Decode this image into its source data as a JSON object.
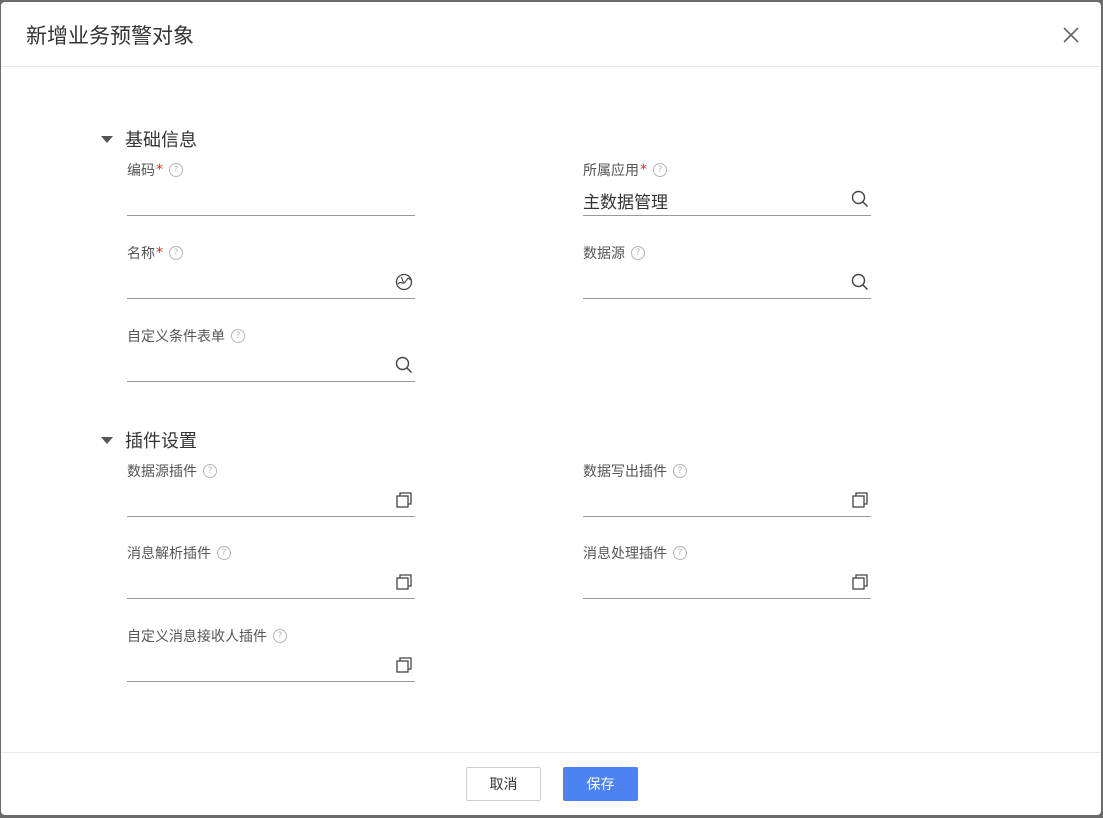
{
  "dialog": {
    "title": "新增业务预警对象"
  },
  "sections": {
    "basic": {
      "title": "基础信息"
    },
    "plugins": {
      "title": "插件设置"
    }
  },
  "fields": {
    "code": {
      "label": "编码",
      "required": "*",
      "value": ""
    },
    "app": {
      "label": "所属应用",
      "required": "*",
      "value": "主数据管理"
    },
    "name": {
      "label": "名称",
      "required": "*",
      "value": ""
    },
    "datasource": {
      "label": "数据源",
      "value": ""
    },
    "custom_form": {
      "label": "自定义条件表单",
      "value": ""
    },
    "ds_plugin": {
      "label": "数据源插件",
      "value": ""
    },
    "write_plugin": {
      "label": "数据写出插件",
      "value": ""
    },
    "parse_plugin": {
      "label": "消息解析插件",
      "value": ""
    },
    "process_plugin": {
      "label": "消息处理插件",
      "value": ""
    },
    "receiver_plugin": {
      "label": "自定义消息接收人插件",
      "value": ""
    }
  },
  "help_glyph": "?",
  "footer": {
    "cancel_label": "取消",
    "save_label": "保存"
  },
  "colors": {
    "primary": "#4d82f3",
    "required": "#e0262c"
  }
}
